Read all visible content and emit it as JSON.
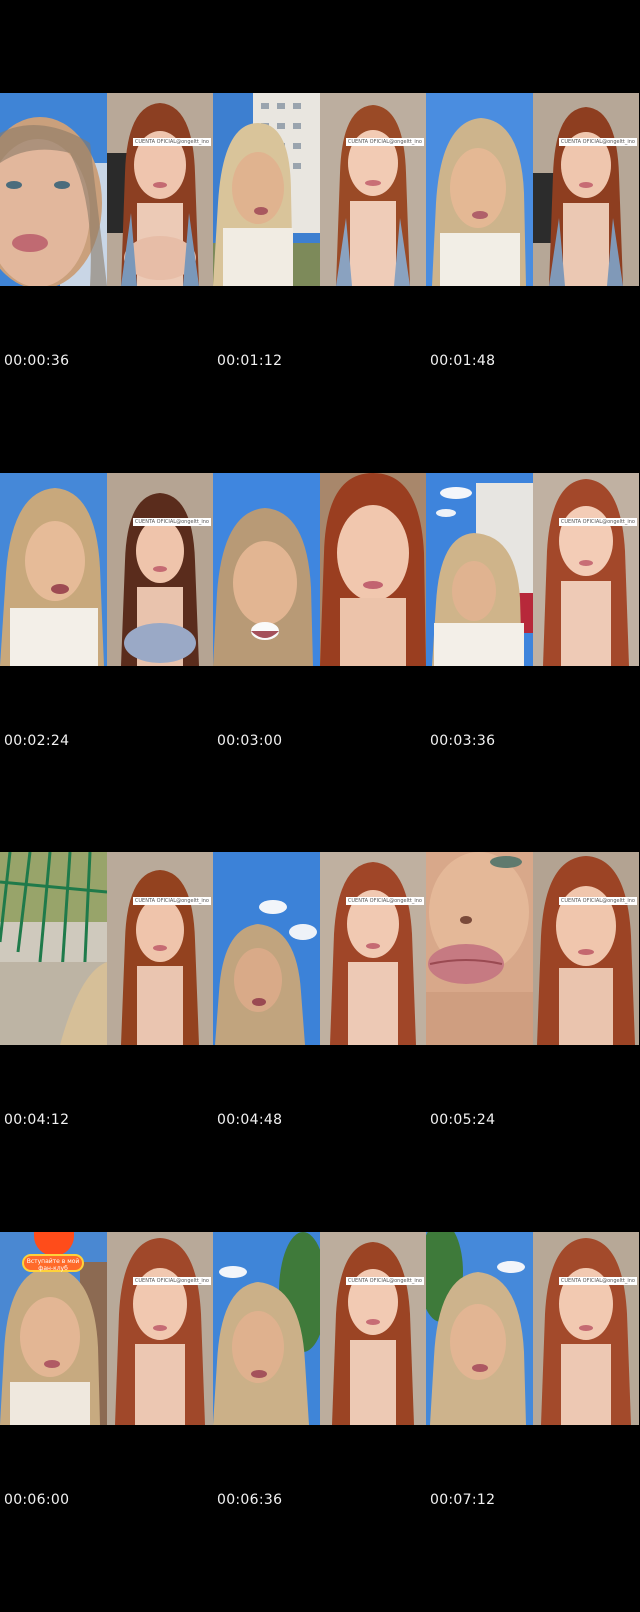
{
  "rows": [
    {
      "timestamps": [
        "00:00:36",
        "00:01:12",
        "00:01:48"
      ],
      "frames": [
        {
          "left": "blonde-closeup-sky",
          "right": "redhead-indoor",
          "watermark": "CUENTA OFICIAL@ongeltt_ino"
        },
        {
          "left": "blonde-outdoor-building",
          "right": "redhead-indoor",
          "watermark": "CUENTA OFICIAL@ongeltt_ino"
        },
        {
          "left": "blonde-outdoor-sky",
          "right": "redhead-indoor",
          "watermark": "CUENTA OFICIAL@ongeltt_ino"
        }
      ]
    },
    {
      "timestamps": [
        "00:02:24",
        "00:03:00",
        "00:03:36"
      ],
      "frames": [
        {
          "left": "blonde-outdoor-sky",
          "right": "redhead-indoor",
          "watermark": "CUENTA OFICIAL@ongeltt_ino"
        },
        {
          "left": "blonde-outdoor-sky",
          "right": "redhead-closeup",
          "watermark": "CUENTA OFICIAL@ongeltt_ino"
        },
        {
          "left": "blonde-outdoor-building",
          "right": "redhead-indoor",
          "watermark": "CUENTA OFICIAL@ongeltt_ino"
        }
      ]
    },
    {
      "timestamps": [
        "00:04:12",
        "00:04:48",
        "00:05:24"
      ],
      "frames": [
        {
          "left": "playground-fence",
          "right": "redhead-indoor",
          "watermark": "CUENTA OFICIAL@ongeltt_ino"
        },
        {
          "left": "blonde-outdoor-sky",
          "right": "redhead-indoor",
          "watermark": "CUENTA OFICIAL@ongeltt_ino"
        },
        {
          "left": "lips-closeup",
          "right": "redhead-indoor",
          "watermark": "CUENTA OFICIAL@ongeltt_ino"
        }
      ]
    },
    {
      "timestamps": [
        "00:06:00",
        "00:06:36",
        "00:07:12"
      ],
      "frames": [
        {
          "left": "blonde-outdoor-fanclub",
          "right": "redhead-indoor",
          "watermark": "CUENTA OFICIAL@ongeltt_ino",
          "badge": "Вступайте в мой фан-клуб"
        },
        {
          "left": "blonde-outdoor-trees",
          "right": "redhead-indoor",
          "watermark": "CUENTA OFICIAL@ongeltt_ino"
        },
        {
          "left": "blonde-outdoor-trees",
          "right": "redhead-indoor",
          "watermark": "CUENTA OFICIAL@ongeltt_ino"
        }
      ]
    }
  ]
}
